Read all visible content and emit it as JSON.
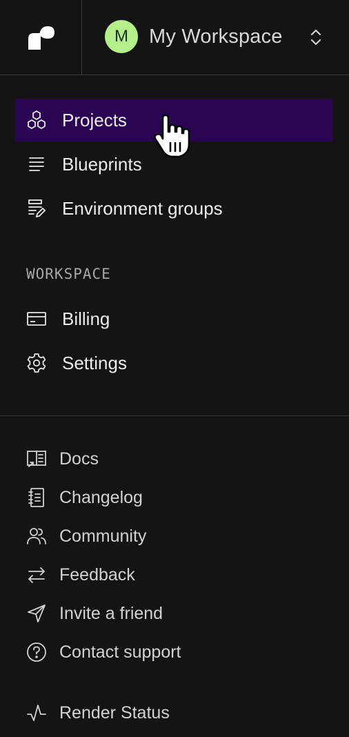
{
  "workspace": {
    "avatar_letter": "M",
    "name": "My Workspace"
  },
  "nav": [
    {
      "label": "Projects",
      "icon": "projects-icon",
      "active": true
    },
    {
      "label": "Blueprints",
      "icon": "blueprints-icon"
    },
    {
      "label": "Environment groups",
      "icon": "environment-groups-icon"
    }
  ],
  "workspace_section": {
    "title": "WORKSPACE",
    "items": [
      {
        "label": "Billing",
        "icon": "credit-card-icon"
      },
      {
        "label": "Settings",
        "icon": "gear-icon"
      }
    ]
  },
  "footer": [
    {
      "label": "Docs",
      "icon": "docs-icon"
    },
    {
      "label": "Changelog",
      "icon": "changelog-icon"
    },
    {
      "label": "Community",
      "icon": "users-icon"
    },
    {
      "label": "Feedback",
      "icon": "arrows-swap-icon"
    },
    {
      "label": "Invite a friend",
      "icon": "paper-plane-icon"
    },
    {
      "label": "Contact support",
      "icon": "help-circle-icon"
    },
    {
      "label": "Render Status",
      "icon": "activity-icon"
    }
  ],
  "colors": {
    "background": "#141414",
    "active_bg": "#2a0552",
    "avatar": "#b4ef8a",
    "divider": "#3a3a3a"
  }
}
